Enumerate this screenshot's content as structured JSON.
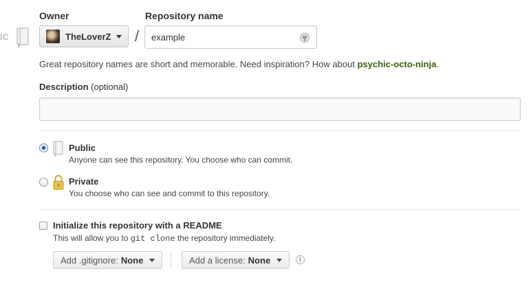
{
  "edge_fragment": "IC",
  "owner": {
    "label": "Owner",
    "selected": "TheLoverZ"
  },
  "repository": {
    "label": "Repository name",
    "separator": "/",
    "value": "example"
  },
  "name_hint": {
    "text": "Great repository names are short and memorable. Need inspiration? How about ",
    "suggestion": "psychic-octo-ninja",
    "suffix": "."
  },
  "description": {
    "label": "Description",
    "optional": "(optional)",
    "value": ""
  },
  "visibility": {
    "public": {
      "title": "Public",
      "description": "Anyone can see this repository. You choose who can commit.",
      "checked": true
    },
    "private": {
      "title": "Private",
      "description": "You choose who can see and commit to this repository.",
      "checked": false
    }
  },
  "readme": {
    "title": "Initialize this repository with a README",
    "desc_before": "This will allow you to ",
    "desc_code": "git clone",
    "desc_after": " the repository immediately.",
    "checked": false
  },
  "gitignore": {
    "prefix": "Add .gitignore:",
    "value": "None"
  },
  "license": {
    "prefix": "Add a license:",
    "value": "None"
  },
  "info_glyph": "i",
  "colors": {
    "suggestion_link": "#3a5f0b",
    "radio_checked": "#2e5f9e",
    "lock_gold": "#e8c04a"
  }
}
